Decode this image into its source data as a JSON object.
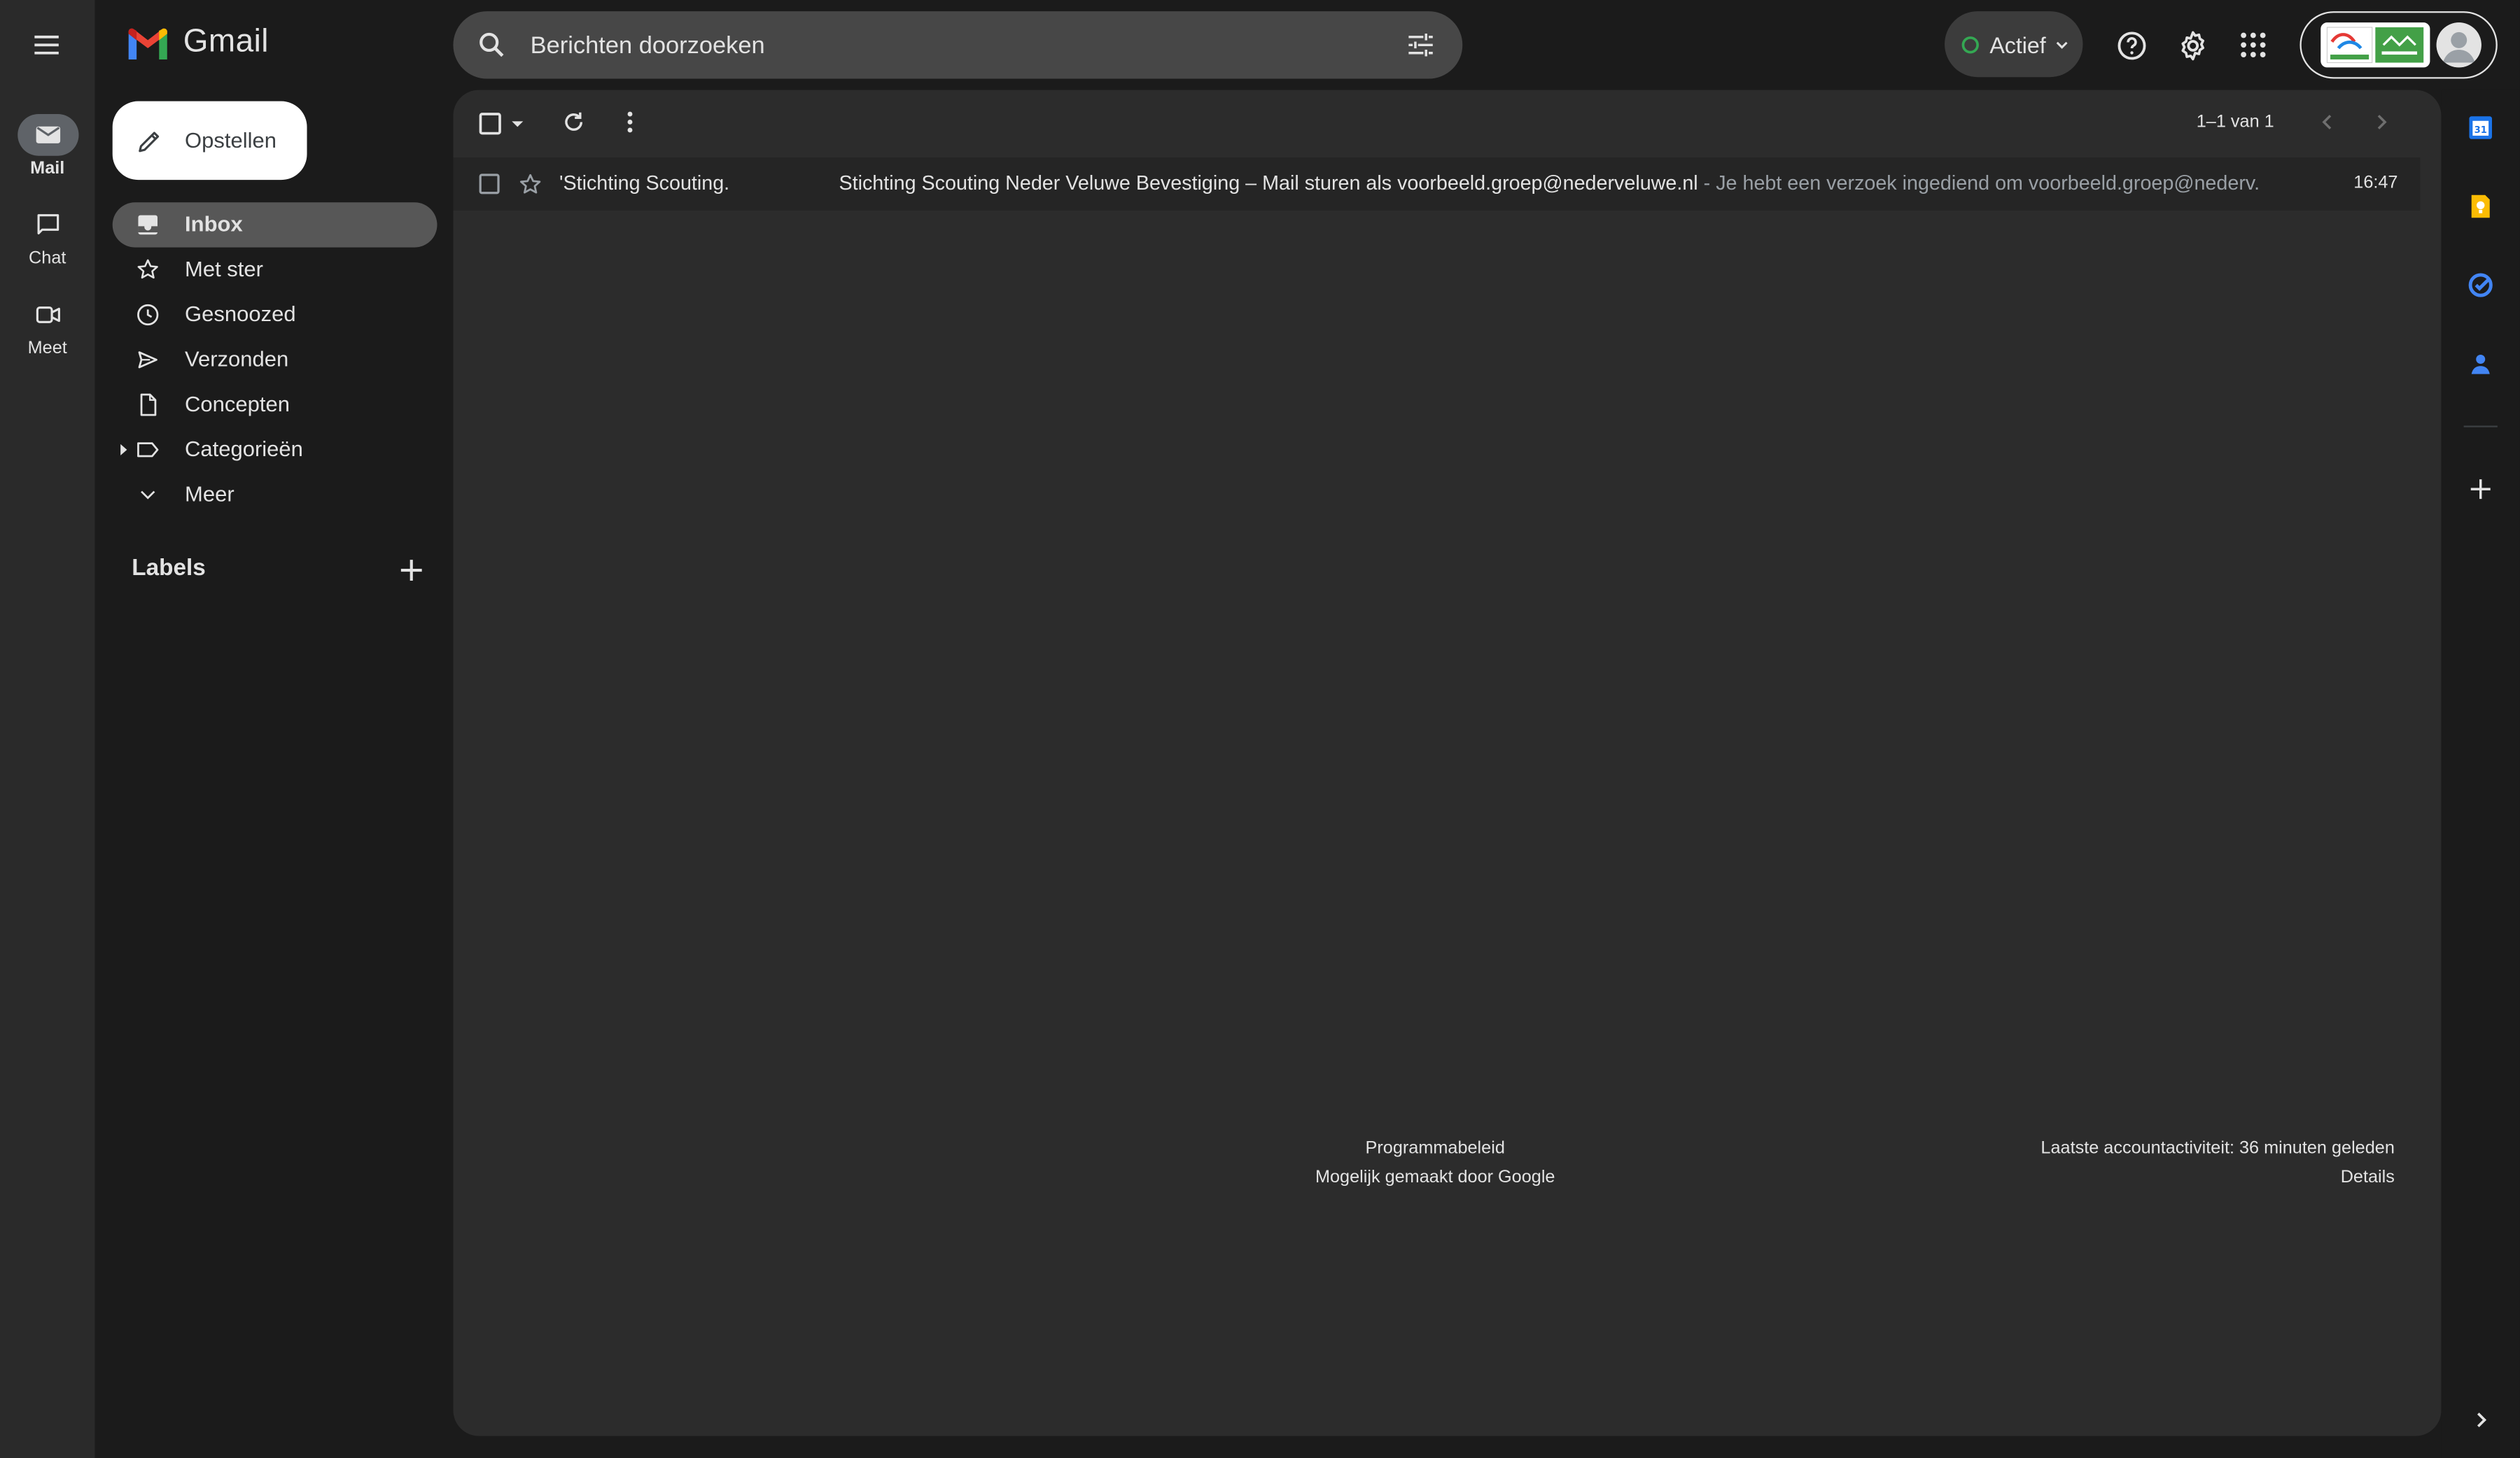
{
  "app": {
    "name": "Gmail"
  },
  "rail": {
    "items": [
      {
        "label": "Mail",
        "icon": "mail-icon",
        "active": true
      },
      {
        "label": "Chat",
        "icon": "chat-icon",
        "active": false
      },
      {
        "label": "Meet",
        "icon": "meet-icon",
        "active": false
      }
    ]
  },
  "search": {
    "placeholder": "Berichten doorzoeken"
  },
  "status": {
    "label": "Actief",
    "color": "#34a853"
  },
  "compose": {
    "label": "Opstellen"
  },
  "nav": {
    "items": [
      {
        "label": "Inbox",
        "icon": "inbox-icon",
        "active": true
      },
      {
        "label": "Met ster",
        "icon": "star-icon",
        "active": false
      },
      {
        "label": "Gesnoozed",
        "icon": "clock-icon",
        "active": false
      },
      {
        "label": "Verzonden",
        "icon": "send-icon",
        "active": false
      },
      {
        "label": "Concepten",
        "icon": "draft-icon",
        "active": false
      },
      {
        "label": "Categorieën",
        "icon": "label-icon",
        "active": false
      },
      {
        "label": "Meer",
        "icon": "chevron-down-icon",
        "active": false
      }
    ]
  },
  "labels": {
    "title": "Labels"
  },
  "toolbar": {
    "pagination": "1–1 van 1"
  },
  "emails": [
    {
      "sender": "'Stichting Scouting.",
      "subject": "Stichting Scouting Neder Veluwe Bevestiging – Mail sturen als voorbeeld.groep@nederveluwe.nl",
      "snippet": " - Je hebt een verzoek ingediend om voorbeeld.groep@nederv...",
      "time": "16:47"
    }
  ],
  "footer": {
    "policy": "Programmabeleid",
    "powered": "Mogelijk gemaakt door Google",
    "activity": "Laatste accountactiviteit: 36 minuten geleden",
    "details": "Details"
  },
  "colors": {
    "background": "#1b1b1b",
    "panel": "#2c2c2c",
    "active_nav": "#575757",
    "text": "#e3e3e3"
  }
}
